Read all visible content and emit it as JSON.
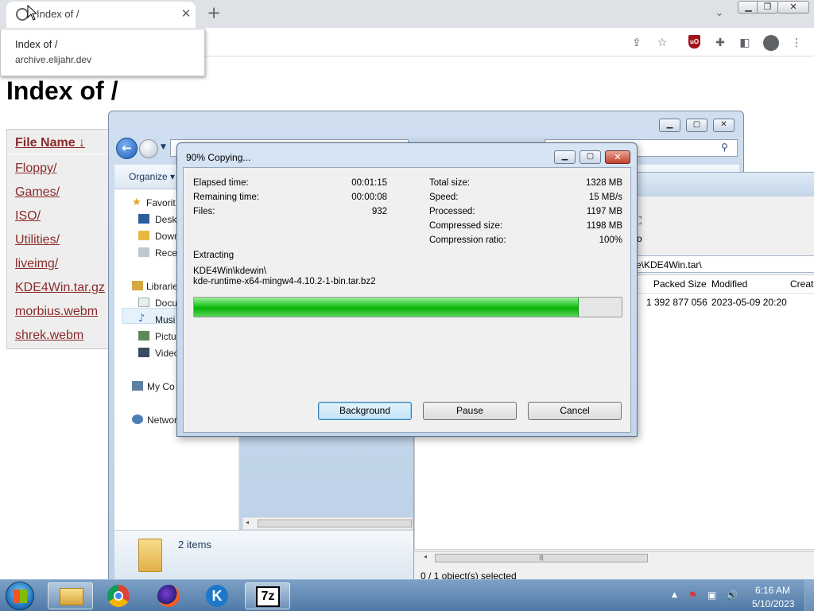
{
  "browser": {
    "tab_title": "Index of /",
    "tab_close": "✕",
    "new_tab": "+",
    "tooltip_title": "Index of /",
    "tooltip_url": "archive.elijahr.dev"
  },
  "page": {
    "heading": "Index of /",
    "column_header": "File Name  ↓",
    "files": [
      "Floppy/",
      "Games/",
      "ISO/",
      "Utilities/",
      "liveimg/",
      "KDE4Win.tar.gz",
      "morbius.webm",
      "shrek.webm"
    ]
  },
  "explorer": {
    "organize": "Organize",
    "nav_items": {
      "favorites": "Favorit",
      "desktop": "Deskt",
      "downloads": "Down",
      "recent": "Recen",
      "libraries": "Librarie",
      "documents": "Docu",
      "music": "Musi",
      "pictures": "Pictu",
      "videos": "Video",
      "computer": "My Co",
      "network": "Networ"
    },
    "items_count": "2 items"
  },
  "sevenzip": {
    "path": "e\\KDE4Win.tar\\",
    "toolbar_fragment": "o",
    "columns": [
      "Packed Size",
      "Modified",
      "Create"
    ],
    "row": {
      "packed_size": "1 392 877 056",
      "modified": "2023-05-09 20:20"
    },
    "status": "0 / 1 object(s) selected"
  },
  "dialog": {
    "title": "90% Copying...",
    "progress_percent": 90,
    "left_stats": [
      {
        "label": "Elapsed time:",
        "value": "00:01:15"
      },
      {
        "label": "Remaining time:",
        "value": "00:00:08"
      },
      {
        "label": "Files:",
        "value": "932"
      }
    ],
    "right_stats": [
      {
        "label": "Total size:",
        "value": "1328 MB"
      },
      {
        "label": "Speed:",
        "value": "15 MB/s"
      },
      {
        "label": "Processed:",
        "value": "1197 MB"
      },
      {
        "label": "Compressed size:",
        "value": "1198 MB"
      },
      {
        "label": "Compression ratio:",
        "value": "100%"
      }
    ],
    "operation": "Extracting",
    "current_path": "KDE4Win\\kdewin\\",
    "current_file": "kde-runtime-x64-mingw4-4.10.2-1-bin.tar.bz2",
    "buttons": {
      "background": "Background",
      "pause": "Pause",
      "cancel": "Cancel"
    }
  },
  "taskbar": {
    "time": "6:16 AM",
    "date": "5/10/2023",
    "sevenzip_label": "7z",
    "kde_label": "K"
  },
  "colors": {
    "link": "#8b2a2a",
    "progress": "#21c321"
  }
}
